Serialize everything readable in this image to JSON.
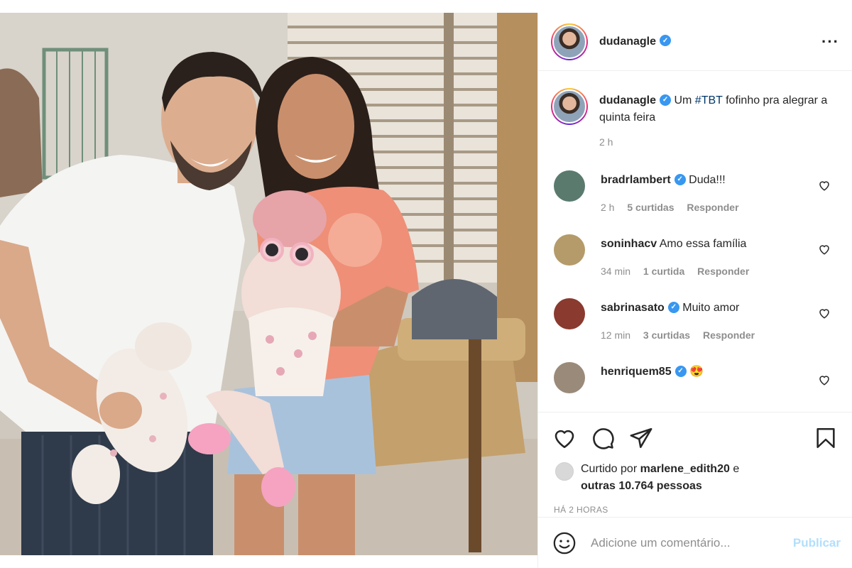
{
  "post": {
    "image_alt": "Family photo",
    "author": {
      "username": "dudanagle",
      "verified": true
    },
    "more_icon": "more-options-icon"
  },
  "caption": {
    "username": "dudanagle",
    "text_before": "Um ",
    "hashtag": "#TBT",
    "text_after": " fofinho pra alegrar a quinta feira",
    "time": "2 h"
  },
  "comments": [
    {
      "username": "bradrlambert",
      "verified": true,
      "text": "Duda!!!",
      "time": "2 h",
      "likes": "5 curtidas",
      "reply": "Responder",
      "avatar_color": "#5a7a6e"
    },
    {
      "username": "soninhacv",
      "verified": false,
      "text": "Amo essa família",
      "time": "34 min",
      "likes": "1 curtida",
      "reply": "Responder",
      "avatar_color": "#b59b6a"
    },
    {
      "username": "sabrinasato",
      "verified": true,
      "text": "Muito amor",
      "time": "12 min",
      "likes": "3 curtidas",
      "reply": "Responder",
      "avatar_color": "#8a3a2e"
    },
    {
      "username": "henriquem85",
      "verified": true,
      "text": "😍",
      "time": "",
      "likes": "",
      "reply": "",
      "avatar_color": "#9a8a7a"
    }
  ],
  "likes": {
    "prefix": "Curtido por ",
    "user": "marlene_edith20",
    "conjunction": " e",
    "others": "outras 10.764 pessoas"
  },
  "posted": "HÁ 2 HORAS",
  "add_comment": {
    "placeholder": "Adicione um comentário...",
    "publish": "Publicar"
  },
  "colors": {
    "verified_blue": "#3897f0",
    "hashtag": "#00376b",
    "muted": "#8e8e8e",
    "publish_disabled": "#b2dffc"
  }
}
